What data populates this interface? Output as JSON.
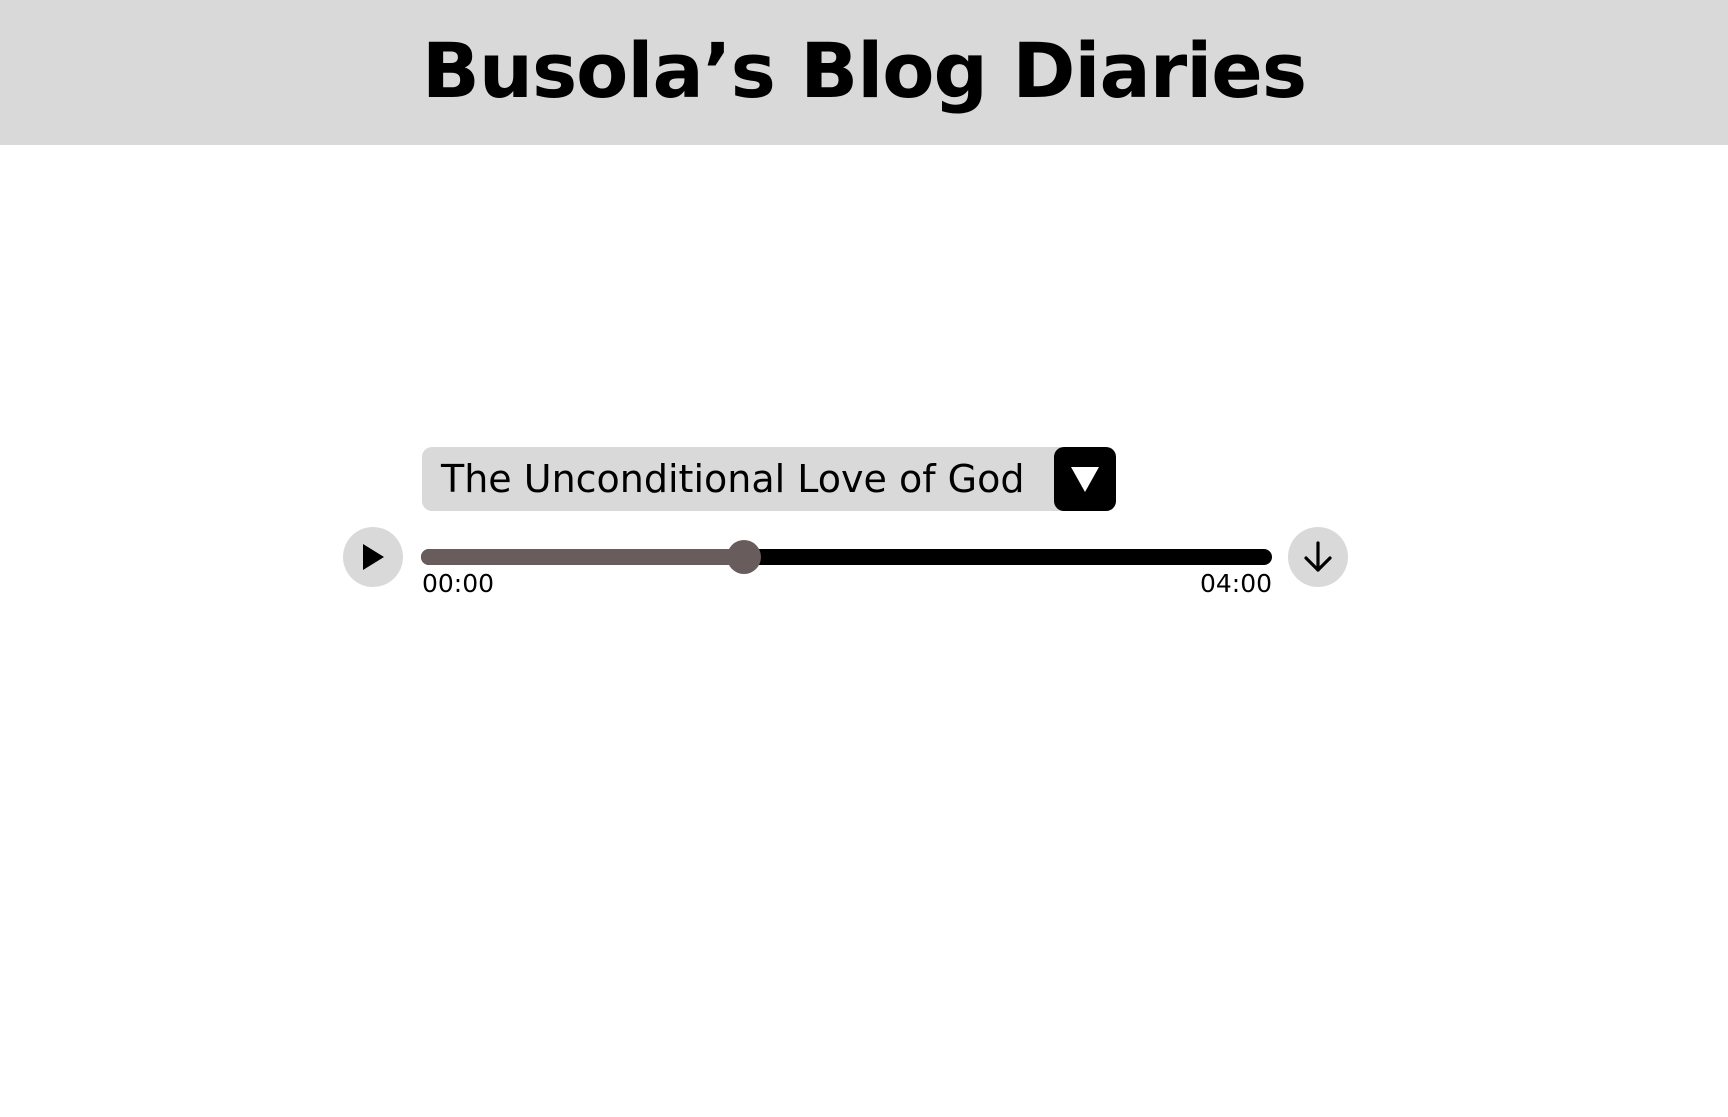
{
  "header": {
    "title": "Busola’s Blog Diaries",
    "background": "#d9d9d9"
  },
  "player": {
    "track_title": "The Unconditional Love of God",
    "current_time": "00:00",
    "total_time": "04:00",
    "progress_fraction": 0.38,
    "colors": {
      "track": "#000000",
      "fill": "#685c5c",
      "button_bg": "#d9d9d9"
    },
    "icons": {
      "play": "play-icon",
      "dropdown": "triangle-down-icon",
      "download": "arrow-down-icon"
    }
  }
}
